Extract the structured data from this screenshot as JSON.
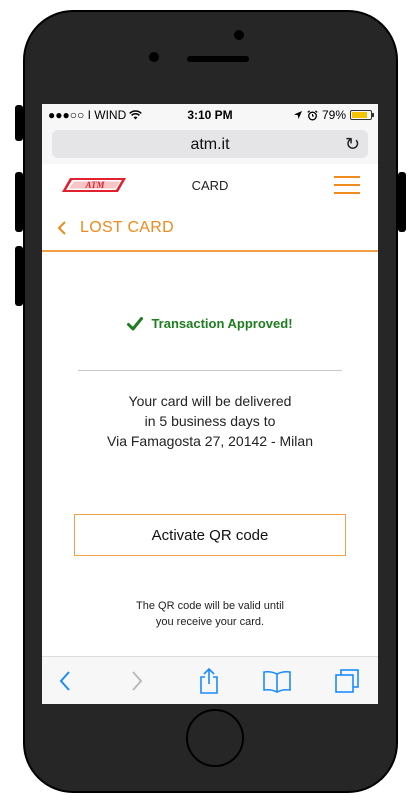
{
  "status_bar": {
    "carrier": "●●●○○ I WIND",
    "time": "3:10 PM",
    "battery": "79%"
  },
  "browser": {
    "url": "atm.it"
  },
  "header": {
    "logo_text": "ATM",
    "title": "CARD"
  },
  "page": {
    "title": "LOST CARD"
  },
  "content": {
    "approved_text": "Transaction Approved!",
    "delivery_lines": [
      "Your card will be delivered",
      "in 5 business days to",
      "Via Famagosta 27, 20142 - Milan"
    ],
    "qr_button_label": "Activate QR code",
    "qr_note_lines": [
      "The QR code will be valid until",
      "you receive your card."
    ]
  },
  "colors": {
    "accent": "#f08a1c",
    "success": "#1e7d1e",
    "toolbar_icon": "#1a8cff"
  }
}
